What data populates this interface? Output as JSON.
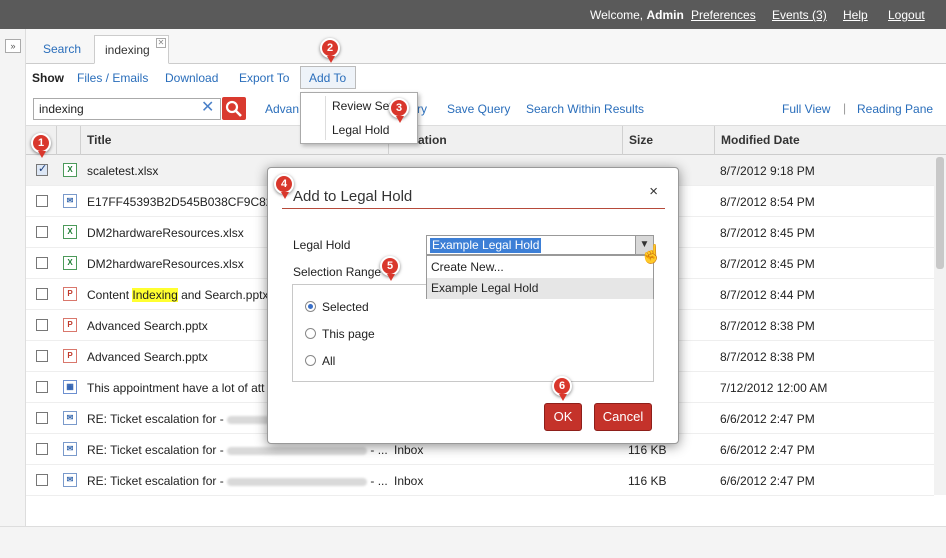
{
  "topbar": {
    "welcome_prefix": "Welcome,",
    "user": "Admin",
    "links": [
      "Preferences",
      "Events (3)",
      "Help",
      "Logout"
    ]
  },
  "tabs": [
    {
      "label": "Search"
    },
    {
      "label": "indexing"
    }
  ],
  "menubar": {
    "show": "Show",
    "items": [
      "Files / Emails",
      "Download",
      "Export To",
      "Add To"
    ]
  },
  "search": {
    "value": "indexing",
    "links": [
      "Advan",
      "ry",
      "Save Query",
      "Search Within Results"
    ],
    "right_links": [
      "Full View",
      "Reading Pane"
    ]
  },
  "add_to_menu": [
    "Review Set",
    "Legal Hold"
  ],
  "grid": {
    "columns": [
      "Title",
      "ation",
      "Size",
      "Modified Date"
    ],
    "rows": [
      {
        "icon": "excel-icon",
        "title": "scaletest.xlsx",
        "folder": "",
        "size": "",
        "date": "8/7/2012 9:18 PM",
        "checked": true
      },
      {
        "icon": "email-icon",
        "title": "E17FF45393B2D545B038CF9C8280D",
        "folder": "",
        "size": "",
        "date": "8/7/2012 8:54 PM",
        "checked": false
      },
      {
        "icon": "excel-icon",
        "title": "DM2hardwareResources.xlsx",
        "folder": "",
        "size": "",
        "date": "8/7/2012 8:45 PM",
        "checked": false
      },
      {
        "icon": "excel-icon",
        "title": "DM2hardwareResources.xlsx",
        "folder": "",
        "size": "",
        "date": "8/7/2012 8:45 PM",
        "checked": false
      },
      {
        "icon": "powerpoint-icon",
        "title_prefix": "Content ",
        "title_highlight": "Indexing",
        "title_suffix": " and Search.pptx",
        "folder": "",
        "size": "",
        "date": "8/7/2012 8:44 PM",
        "checked": false
      },
      {
        "icon": "powerpoint-icon",
        "title": "Advanced Search.pptx",
        "folder": "",
        "size": "",
        "date": "8/7/2012 8:38 PM",
        "checked": false
      },
      {
        "icon": "powerpoint-icon",
        "title": "Advanced Search.pptx",
        "folder": "",
        "size": "",
        "date": "8/7/2012 8:38 PM",
        "checked": false
      },
      {
        "icon": "appointment-icon",
        "title": "This appointment have a lot of att",
        "folder": "",
        "size": "",
        "date": "7/12/2012 12:00 AM",
        "checked": false
      },
      {
        "icon": "email-icon",
        "title": "RE: Ticket escalation for - ",
        "folder": "",
        "size": "",
        "date": "6/6/2012 2:47 PM",
        "checked": false
      },
      {
        "icon": "email-icon",
        "title": "RE: Ticket escalation for - ",
        "tail": " - ...",
        "folder": "Inbox",
        "size": "116 KB",
        "date": "6/6/2012 2:47 PM",
        "checked": false
      },
      {
        "icon": "email-icon",
        "title": "RE: Ticket escalation for - ",
        "tail": " - ...",
        "folder": "Inbox",
        "size": "116 KB",
        "date": "6/6/2012 2:47 PM",
        "checked": false
      }
    ]
  },
  "dialog": {
    "title": "Add to Legal Hold",
    "legal_hold_label": "Legal Hold",
    "legal_hold_value": "Example Legal Hold",
    "options": [
      "Create New...",
      "Example Legal Hold"
    ],
    "selection_range_label": "Selection Range",
    "radios": [
      "Selected",
      "This page",
      "All"
    ],
    "ok": "OK",
    "cancel": "Cancel",
    "close": "×"
  },
  "markers": [
    "1",
    "2",
    "3",
    "4",
    "5",
    "6"
  ],
  "colors": {
    "accent": "#d9372c",
    "link": "#2a6ebb",
    "topbar": "#5a5a5a"
  }
}
